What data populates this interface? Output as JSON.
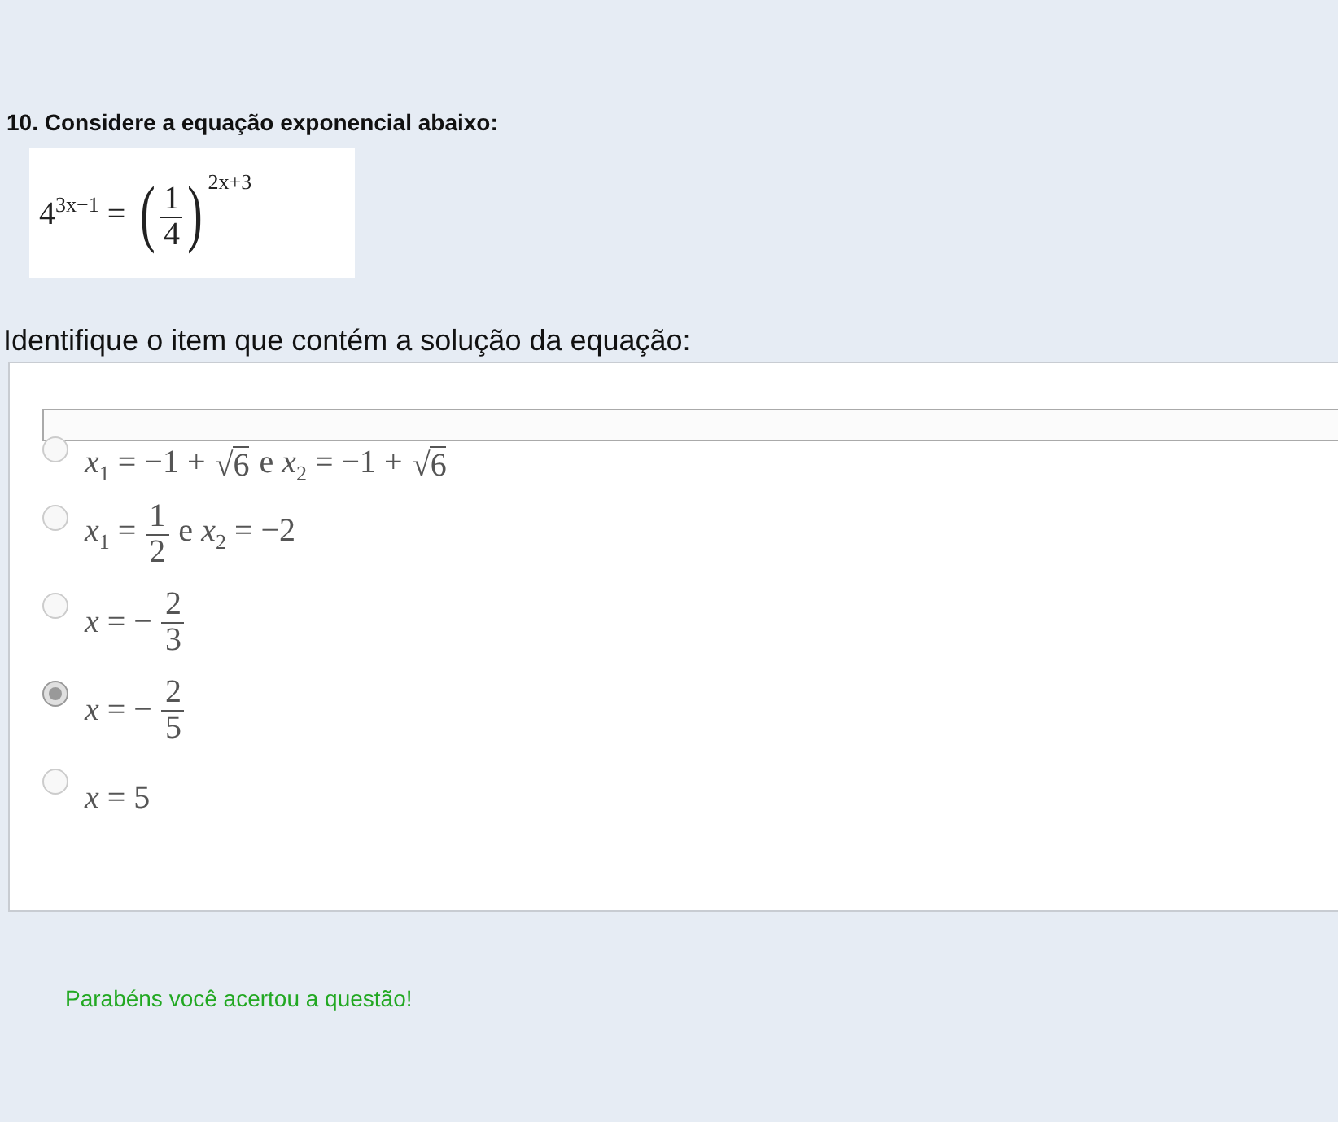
{
  "question": {
    "title": "10. Considere a equação exponencial abaixo:",
    "equation": [
      {
        "kind": "text",
        "s": "4$^{3x−1}$ ="
      },
      {
        "kind": "paren",
        "open": "(",
        "num": "1",
        "den": "4",
        "close": ")",
        "exp": "2x+3"
      }
    ],
    "prompt": "Identifique o item que contém a solução da equação:"
  },
  "options": [
    {
      "selected": false,
      "parts": [
        {
          "kind": "text",
          "s": "*x*$_{1}$ = −1 +"
        },
        {
          "kind": "sqrt",
          "sign": "√",
          "s": "6"
        },
        {
          "kind": "text",
          "s": "e *x*$_{2}$ = −1 +"
        },
        {
          "kind": "sqrt",
          "sign": "√",
          "s": "6"
        }
      ]
    },
    {
      "selected": false,
      "parts": [
        {
          "kind": "text",
          "s": "*x*$_{1}$ ="
        },
        {
          "kind": "frac",
          "num": "1",
          "den": "2"
        },
        {
          "kind": "text",
          "s": "e *x*$_{2}$ = −2"
        }
      ]
    },
    {
      "selected": false,
      "parts": [
        {
          "kind": "text",
          "s": "*x* = −"
        },
        {
          "kind": "frac",
          "num": "2",
          "den": "3"
        }
      ]
    },
    {
      "selected": true,
      "parts": [
        {
          "kind": "text",
          "s": "*x* = −"
        },
        {
          "kind": "frac",
          "num": "2",
          "den": "5"
        }
      ]
    },
    {
      "selected": false,
      "parts": [
        {
          "kind": "text",
          "s": "*x* = 5"
        }
      ]
    }
  ],
  "feedback": "Parabéns você acertou a questão!"
}
